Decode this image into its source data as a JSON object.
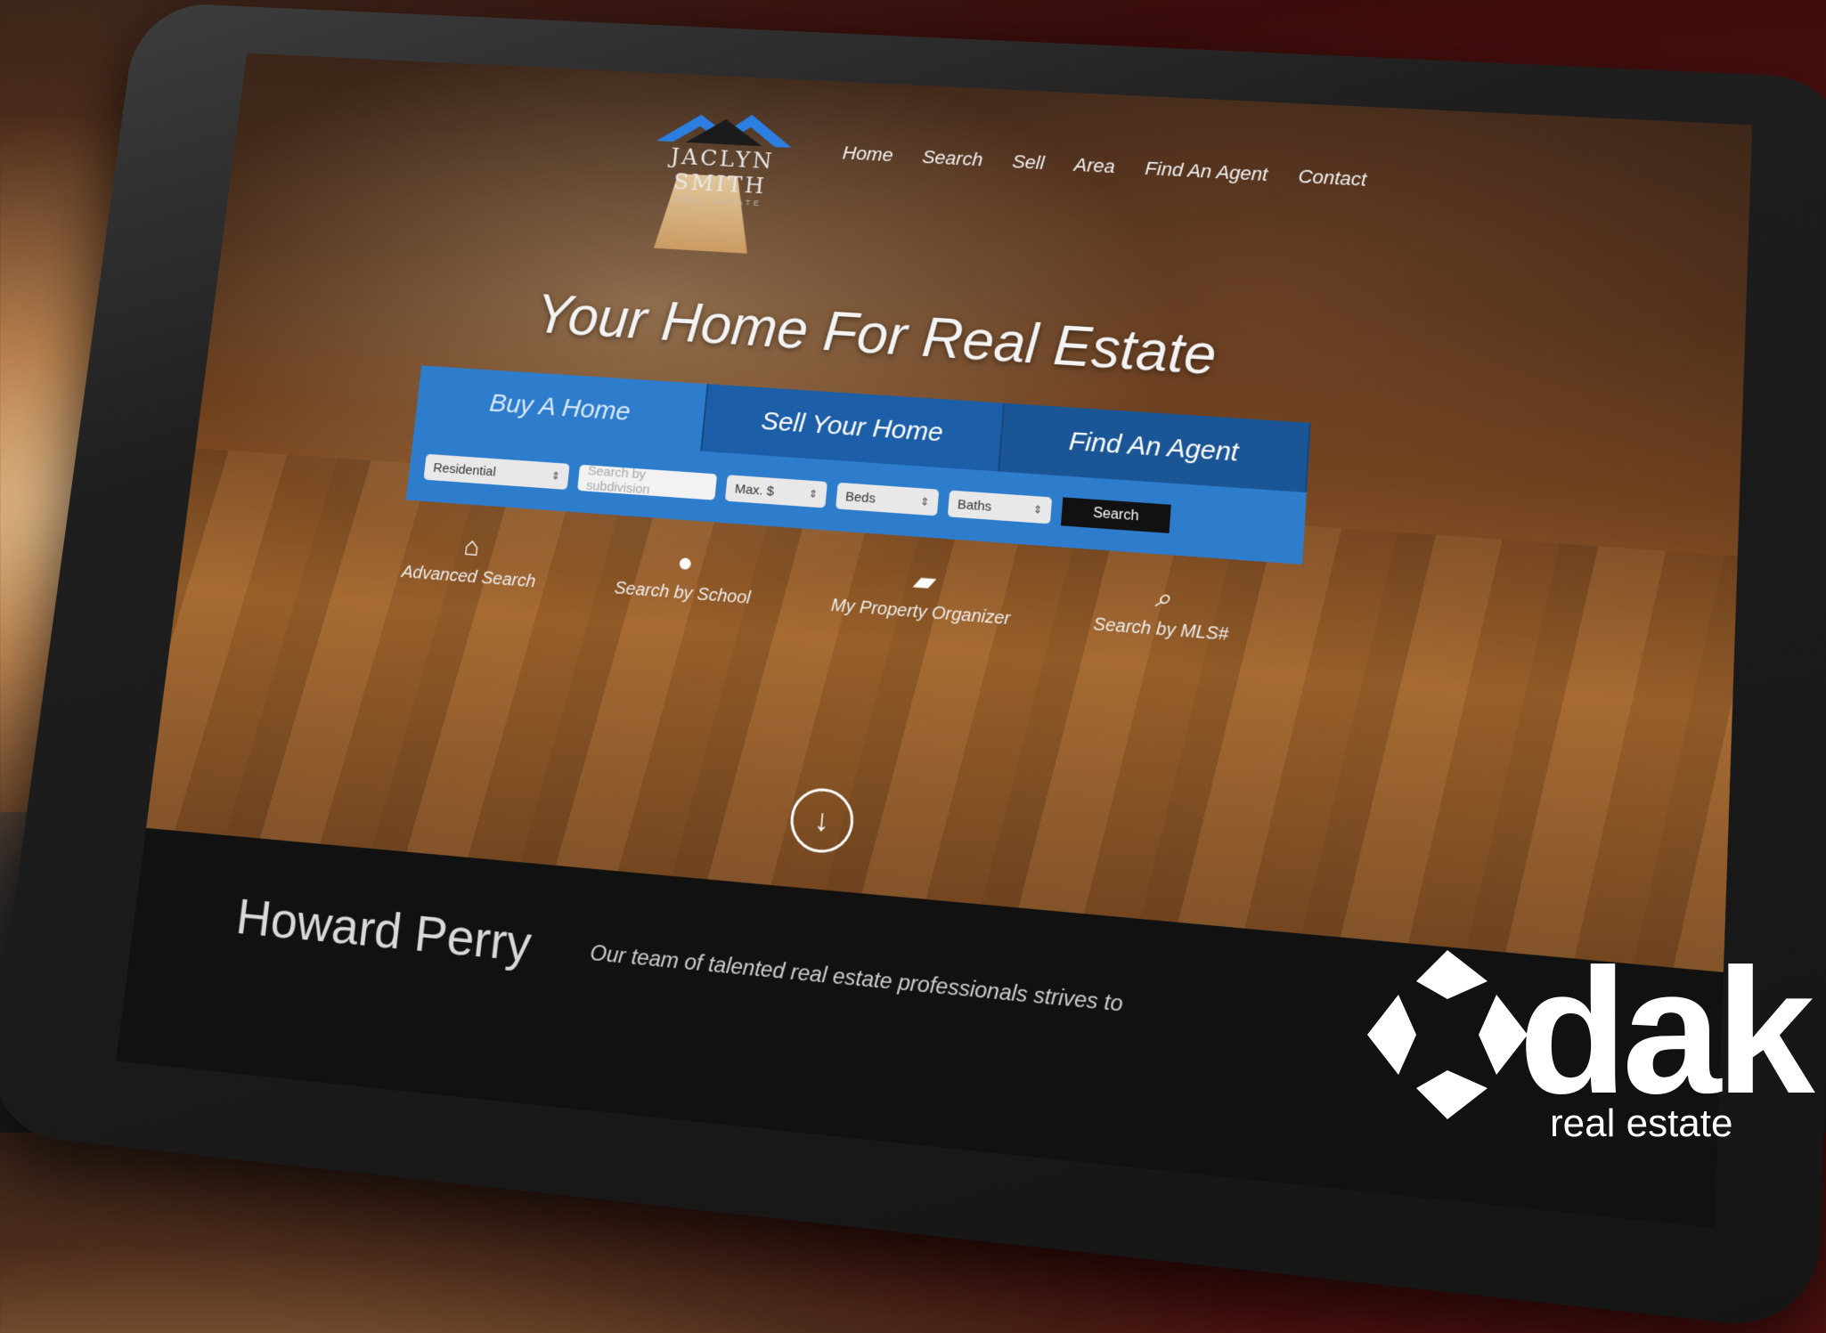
{
  "logo": {
    "name": "JACLYN SMITH",
    "sub": "REAL ESTATE"
  },
  "nav": [
    "Home",
    "Search",
    "Sell",
    "Area",
    "Find An Agent",
    "Contact"
  ],
  "headline": "Your Home For Real Estate",
  "tabs": [
    "Buy A Home",
    "Sell Your Home",
    "Find An Agent"
  ],
  "search": {
    "type_value": "Residential",
    "subdivision_placeholder": "Search by subdivision",
    "max_price": "Max. $",
    "beds": "Beds",
    "baths": "Baths",
    "button": "Search"
  },
  "quick_links": [
    {
      "label": "Advanced Search",
      "icon": "home-icon"
    },
    {
      "label": "Search by School",
      "icon": "apple-icon"
    },
    {
      "label": "My Property Organizer",
      "icon": "folder-icon"
    },
    {
      "label": "Search by MLS#",
      "icon": "magnifier-icon"
    }
  ],
  "footer": {
    "agent_name": "Howard Perry",
    "tagline": "Our team of talented real estate professionals strives to"
  },
  "watermark": {
    "word": "dak",
    "sub": "real estate"
  }
}
